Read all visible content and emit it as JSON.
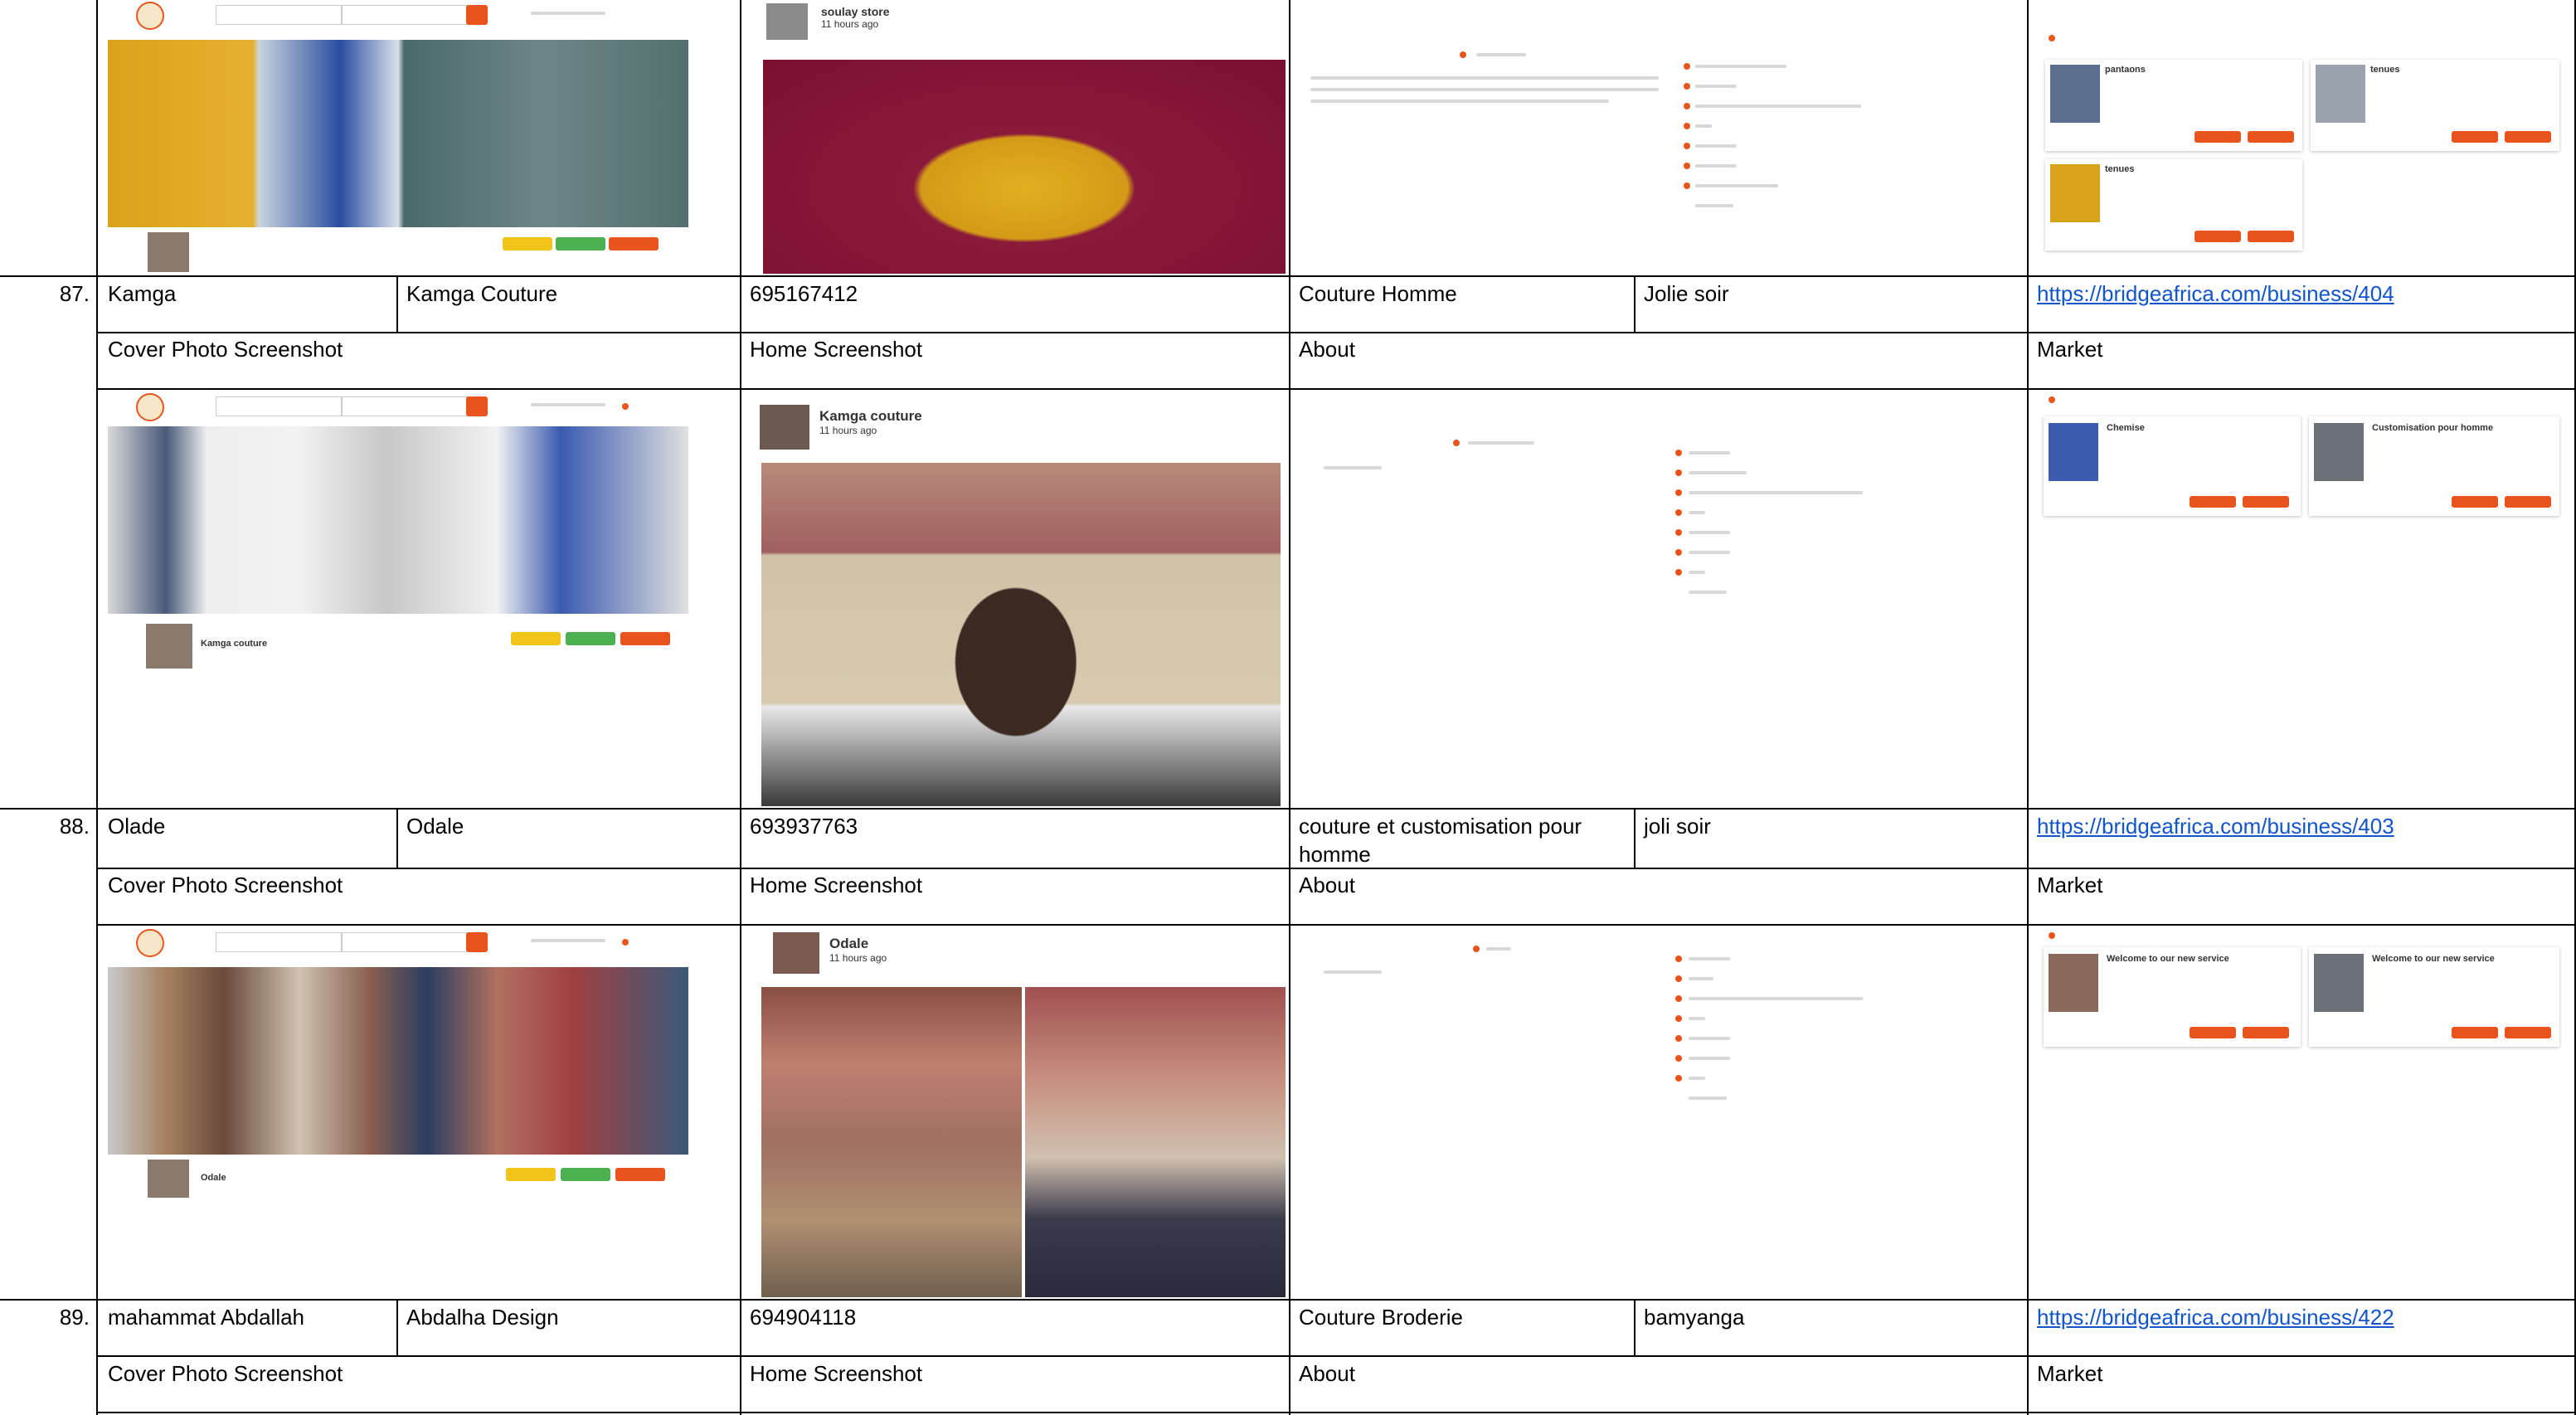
{
  "columns": {
    "cover": "Cover Photo Screenshot",
    "home": "Home Screenshot",
    "about": "About",
    "market": "Market"
  },
  "rows": [
    {
      "number": "87.",
      "owner": "Kamga",
      "business": "Kamga Couture",
      "phone": "695167412",
      "category": "Couture Homme",
      "location": "Jolie soir",
      "link": "https://bridgeafrica.com/business/404",
      "home_title": "Kamga couture",
      "home_time": "11 hours ago",
      "cover_name": "Kamga couture"
    },
    {
      "number": "88.",
      "owner": "Olade",
      "business": "Odale",
      "phone": "693937763",
      "category_line1": "couture et customisation pour",
      "category_line2": "homme",
      "location": "joli soir",
      "link": "https://bridgeafrica.com/business/403",
      "home_title": "Odale",
      "home_time": "11 hours ago",
      "cover_name": "Odale"
    },
    {
      "number": "89.",
      "owner": "mahammat Abdallah",
      "business": "Abdalha Design",
      "phone": "694904118",
      "category": "Couture Broderie",
      "location": "bamyanga",
      "link": "https://bridgeafrica.com/business/422"
    }
  ],
  "top_row": {
    "home_title": "soulay store",
    "home_time": "11 hours ago"
  },
  "market_cards": {
    "r86": [
      "pantaons",
      "tenues",
      "tenues"
    ],
    "r87": [
      "Chemise",
      "Customisation pour homme"
    ],
    "r88": [
      "Welcome to our new service",
      "Welcome to our new service"
    ]
  },
  "colors": {
    "accent": "#e8541c",
    "link": "#1155cc",
    "green": "#4caf50",
    "yellow": "#f0c419"
  }
}
